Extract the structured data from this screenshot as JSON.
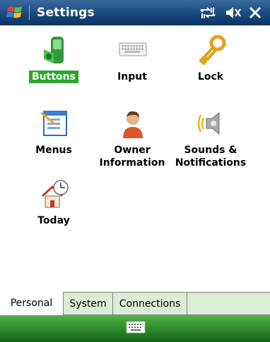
{
  "titlebar": {
    "title": "Settings"
  },
  "icons": [
    {
      "label": "Buttons",
      "icon": "buttons-icon",
      "selected": true
    },
    {
      "label": "Input",
      "icon": "keyboard-icon"
    },
    {
      "label": "Lock",
      "icon": "key-icon"
    },
    {
      "label": "Menus",
      "icon": "menus-icon"
    },
    {
      "label": "Owner",
      "label2": "Information",
      "icon": "owner-icon"
    },
    {
      "label": "Sounds &",
      "label2": "Notifications",
      "icon": "speaker-icon"
    },
    {
      "label": "Today",
      "icon": "today-icon"
    }
  ],
  "tabs": [
    {
      "label": "Personal",
      "active": true
    },
    {
      "label": "System"
    },
    {
      "label": "Connections"
    }
  ],
  "colors": {
    "title_bar": "#1d4f84",
    "selection": "#28a828",
    "softkey_bar": "#2f8a2c",
    "inactive_tab": "#d8efd3"
  }
}
